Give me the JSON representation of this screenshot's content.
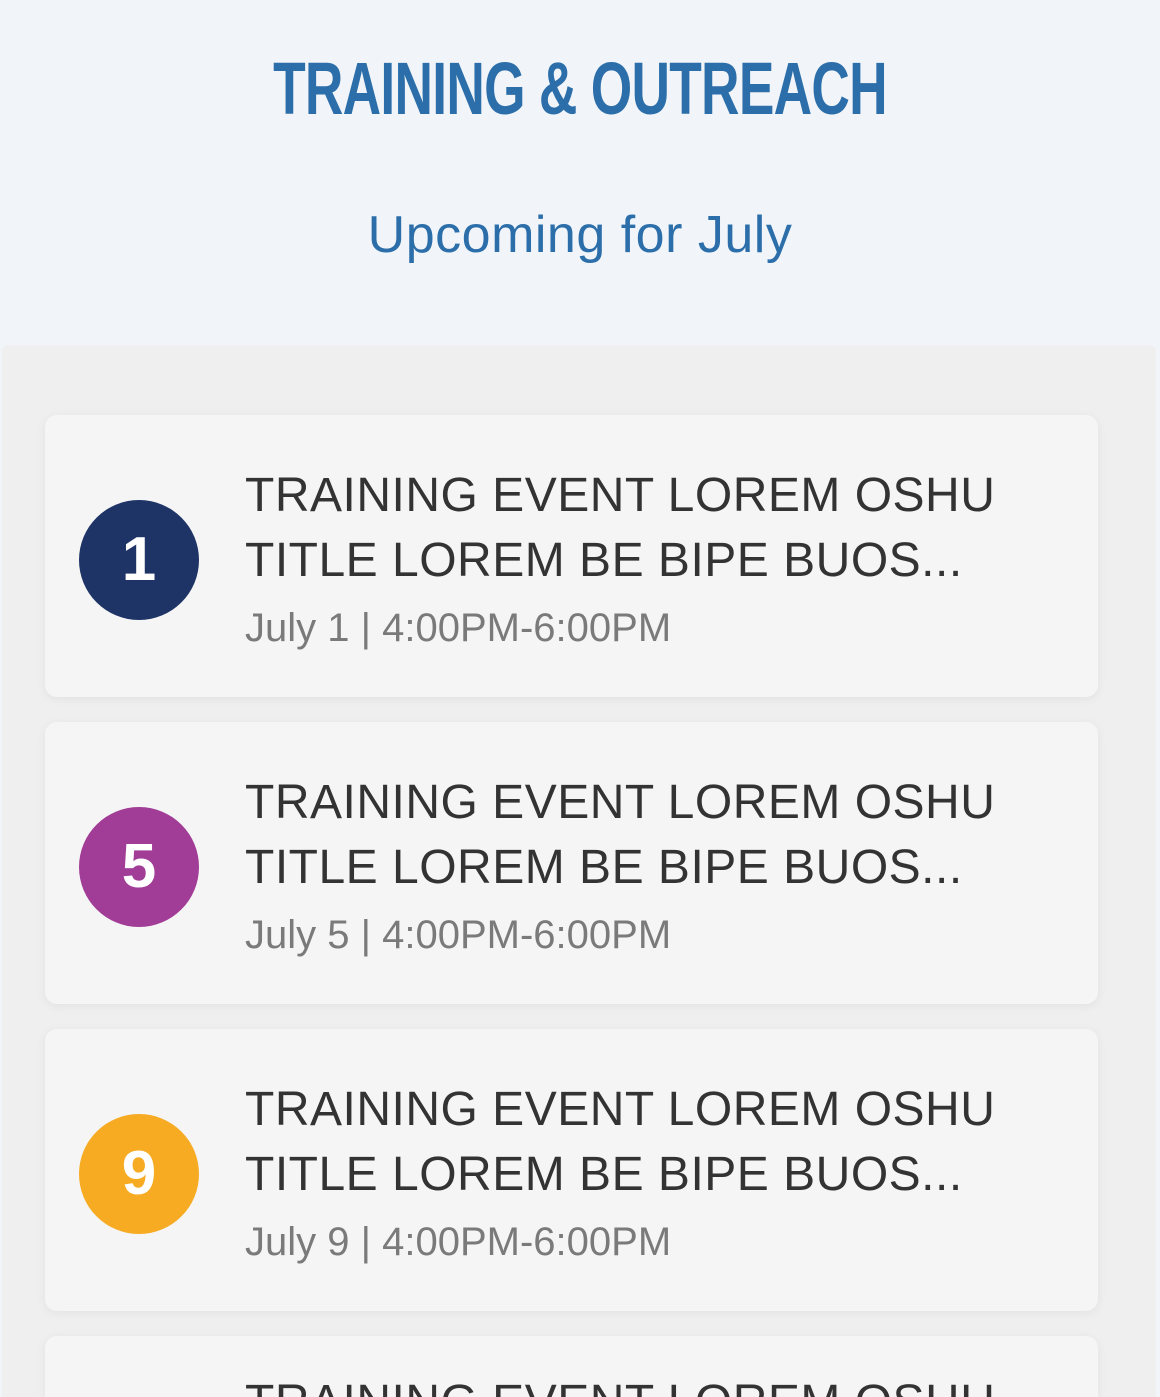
{
  "header": {
    "title": "TRAINING & OUTREACH",
    "subtitle": "Upcoming for July"
  },
  "colors": {
    "title": "#2c6ea9",
    "badge_1": "#1f3466",
    "badge_5": "#a13d96",
    "badge_9": "#f6ab23"
  },
  "events": [
    {
      "day": "1",
      "title": "TRAINING EVENT LOREM OSHU TITLE LOREM BE BIPE BUOS...",
      "when": "July 1 | 4:00PM-6:00PM"
    },
    {
      "day": "5",
      "title": "TRAINING EVENT LOREM OSHU TITLE LOREM BE BIPE BUOS...",
      "when": "July 5 | 4:00PM-6:00PM"
    },
    {
      "day": "9",
      "title": "TRAINING EVENT LOREM OSHU TITLE LOREM BE BIPE BUOS...",
      "when": "July 9 | 4:00PM-6:00PM"
    },
    {
      "title": "TRAINING EVENT LOREM OSHU"
    }
  ]
}
